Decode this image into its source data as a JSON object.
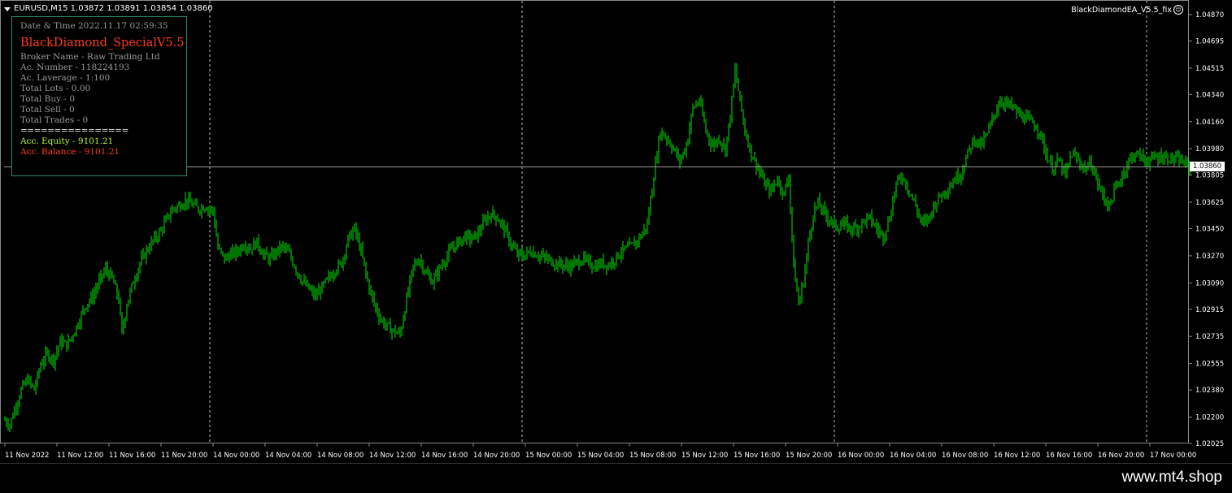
{
  "header": {
    "symbol_info": "EURUSD,M15  1.03872 1.03891 1.03854 1.03860"
  },
  "ea_label": {
    "text": "BlackDiamondEA_V5.5_fix"
  },
  "info_panel": {
    "datetime": "Date & Time 2022.11.17 02:59:35",
    "title": "BlackDiamond_SpecialV5.5",
    "broker": "Broker Name - Raw Trading Ltd",
    "account_number": "Ac. Number - 118224193",
    "leverage": "Ac. Laverage - 1:100",
    "total_lots": "Total Lots - 0.00",
    "total_buy": "Total Buy - 0",
    "total_sell": "Total Sell - 0",
    "total_trades": "Total Trades - 0",
    "separator": "================",
    "equity": "Acc. Equity - 9101.21",
    "balance": "Acc. Balance - 9101.21"
  },
  "current_price": "1.03860",
  "colors": {
    "candle": "#00e600",
    "background": "#000000",
    "equity": "#b7ff2a",
    "balance": "#ff3b1a",
    "title": "#ff3b1a",
    "panel_border": "#2e8b6e"
  },
  "chart_data": {
    "type": "candlestick",
    "price_ticks": [
      "1.04870",
      "1.04695",
      "1.04515",
      "1.04340",
      "1.04160",
      "1.03980",
      "1.03805",
      "1.03625",
      "1.03450",
      "1.03270",
      "1.03090",
      "1.02915",
      "1.02735",
      "1.02555",
      "1.02380",
      "1.02200",
      "1.02025"
    ],
    "price_range": [
      1.02025,
      1.0487
    ],
    "time_ticks": [
      "11 Nov 2022",
      "11 Nov 12:00",
      "11 Nov 16:00",
      "11 Nov 20:00",
      "14 Nov 00:00",
      "14 Nov 04:00",
      "14 Nov 08:00",
      "14 Nov 12:00",
      "14 Nov 16:00",
      "14 Nov 20:00",
      "15 Nov 00:00",
      "15 Nov 04:00",
      "15 Nov 08:00",
      "15 Nov 12:00",
      "15 Nov 16:00",
      "15 Nov 20:00",
      "16 Nov 00:00",
      "16 Nov 04:00",
      "16 Nov 08:00",
      "16 Nov 12:00",
      "16 Nov 16:00",
      "16 Nov 20:00",
      "17 Nov 00:00"
    ],
    "day_separators": [
      "14 Nov 00:00",
      "15 Nov 00:00",
      "16 Nov 00:00",
      "17 Nov 00:00"
    ],
    "close_path": [
      [
        0,
        1.0218
      ],
      [
        6,
        1.0215
      ],
      [
        12,
        1.0225
      ],
      [
        20,
        1.0238
      ],
      [
        28,
        1.0245
      ],
      [
        36,
        1.0238
      ],
      [
        44,
        1.0255
      ],
      [
        52,
        1.0262
      ],
      [
        60,
        1.0258
      ],
      [
        68,
        1.027
      ],
      [
        76,
        1.0268
      ],
      [
        84,
        1.0275
      ],
      [
        92,
        1.0285
      ],
      [
        100,
        1.0295
      ],
      [
        108,
        1.03
      ],
      [
        116,
        1.031
      ],
      [
        124,
        1.0318
      ],
      [
        132,
        1.0312
      ],
      [
        140,
        1.0298
      ],
      [
        144,
        1.0275
      ],
      [
        150,
        1.0295
      ],
      [
        158,
        1.031
      ],
      [
        166,
        1.0322
      ],
      [
        174,
        1.033
      ],
      [
        182,
        1.0337
      ],
      [
        190,
        1.0342
      ],
      [
        198,
        1.035
      ],
      [
        206,
        1.0358
      ],
      [
        214,
        1.036
      ],
      [
        222,
        1.0364
      ],
      [
        230,
        1.0361
      ],
      [
        238,
        1.0358
      ],
      [
        246,
        1.036
      ],
      [
        256,
        1.0357
      ],
      [
        262,
        1.0332
      ],
      [
        270,
        1.0325
      ],
      [
        278,
        1.0328
      ],
      [
        286,
        1.033
      ],
      [
        294,
        1.0335
      ],
      [
        302,
        1.0332
      ],
      [
        310,
        1.0336
      ],
      [
        318,
        1.0328
      ],
      [
        326,
        1.0325
      ],
      [
        334,
        1.033
      ],
      [
        342,
        1.0333
      ],
      [
        350,
        1.0328
      ],
      [
        358,
        1.0318
      ],
      [
        366,
        1.031
      ],
      [
        374,
        1.0305
      ],
      [
        382,
        1.03
      ],
      [
        390,
        1.0306
      ],
      [
        398,
        1.0312
      ],
      [
        406,
        1.0318
      ],
      [
        414,
        1.0322
      ],
      [
        422,
        1.0338
      ],
      [
        430,
        1.0345
      ],
      [
        438,
        1.033
      ],
      [
        446,
        1.031
      ],
      [
        454,
        1.0295
      ],
      [
        462,
        1.0285
      ],
      [
        470,
        1.028
      ],
      [
        478,
        1.0277
      ],
      [
        486,
        1.0275
      ],
      [
        494,
        1.0298
      ],
      [
        502,
        1.032
      ],
      [
        510,
        1.0325
      ],
      [
        518,
        1.0315
      ],
      [
        526,
        1.031
      ],
      [
        534,
        1.0318
      ],
      [
        542,
        1.0325
      ],
      [
        550,
        1.0332
      ],
      [
        558,
        1.0336
      ],
      [
        566,
        1.034
      ],
      [
        574,
        1.0338
      ],
      [
        582,
        1.0342
      ],
      [
        590,
        1.035
      ],
      [
        598,
        1.0355
      ],
      [
        606,
        1.0352
      ],
      [
        614,
        1.0345
      ],
      [
        622,
        1.0335
      ],
      [
        630,
        1.0328
      ],
      [
        638,
        1.0327
      ],
      [
        646,
        1.033
      ],
      [
        654,
        1.0328
      ],
      [
        662,
        1.0326
      ],
      [
        670,
        1.0324
      ],
      [
        678,
        1.0322
      ],
      [
        686,
        1.0321
      ],
      [
        694,
        1.032
      ],
      [
        702,
        1.0322
      ],
      [
        710,
        1.0325
      ],
      [
        718,
        1.0322
      ],
      [
        726,
        1.032
      ],
      [
        734,
        1.0322
      ],
      [
        742,
        1.0321
      ],
      [
        750,
        1.0325
      ],
      [
        758,
        1.033
      ],
      [
        766,
        1.0332
      ],
      [
        774,
        1.0335
      ],
      [
        782,
        1.034
      ],
      [
        790,
        1.0348
      ],
      [
        798,
        1.038
      ],
      [
        806,
        1.041
      ],
      [
        814,
        1.0405
      ],
      [
        822,
        1.0398
      ],
      [
        830,
        1.039
      ],
      [
        838,
        1.04
      ],
      [
        846,
        1.0425
      ],
      [
        854,
        1.043
      ],
      [
        862,
        1.041
      ],
      [
        870,
        1.04
      ],
      [
        878,
        1.0405
      ],
      [
        886,
        1.0398
      ],
      [
        892,
        1.042
      ],
      [
        898,
        1.045
      ],
      [
        904,
        1.043
      ],
      [
        910,
        1.041
      ],
      [
        918,
        1.0395
      ],
      [
        926,
        1.0385
      ],
      [
        934,
        1.0375
      ],
      [
        942,
        1.037
      ],
      [
        950,
        1.0378
      ],
      [
        958,
        1.0368
      ],
      [
        964,
        1.038
      ],
      [
        970,
        1.032
      ],
      [
        976,
        1.0295
      ],
      [
        982,
        1.031
      ],
      [
        988,
        1.0335
      ],
      [
        994,
        1.0355
      ],
      [
        1000,
        1.0362
      ],
      [
        1008,
        1.0355
      ],
      [
        1016,
        1.035
      ],
      [
        1024,
        1.0346
      ],
      [
        1032,
        1.0348
      ],
      [
        1040,
        1.0345
      ],
      [
        1048,
        1.0346
      ],
      [
        1056,
        1.035
      ],
      [
        1064,
        1.0352
      ],
      [
        1072,
        1.0345
      ],
      [
        1080,
        1.034
      ],
      [
        1088,
        1.0352
      ],
      [
        1096,
        1.0375
      ],
      [
        1104,
        1.038
      ],
      [
        1112,
        1.037
      ],
      [
        1120,
        1.036
      ],
      [
        1128,
        1.0348
      ],
      [
        1136,
        1.0352
      ],
      [
        1144,
        1.0362
      ],
      [
        1152,
        1.0368
      ],
      [
        1160,
        1.0372
      ],
      [
        1168,
        1.0378
      ],
      [
        1176,
        1.0382
      ],
      [
        1184,
        1.0395
      ],
      [
        1192,
        1.0405
      ],
      [
        1200,
        1.04
      ],
      [
        1208,
        1.0408
      ],
      [
        1216,
        1.042
      ],
      [
        1224,
        1.043
      ],
      [
        1232,
        1.0428
      ],
      [
        1240,
        1.0425
      ],
      [
        1248,
        1.042
      ],
      [
        1256,
        1.0418
      ],
      [
        1264,
        1.0415
      ],
      [
        1272,
        1.041
      ],
      [
        1280,
        1.0395
      ],
      [
        1288,
        1.0385
      ],
      [
        1296,
        1.039
      ],
      [
        1304,
        1.038
      ],
      [
        1312,
        1.0395
      ],
      [
        1320,
        1.039
      ],
      [
        1328,
        1.0385
      ],
      [
        1336,
        1.0388
      ],
      [
        1344,
        1.0375
      ],
      [
        1352,
        1.0365
      ],
      [
        1358,
        1.036
      ],
      [
        1366,
        1.0372
      ],
      [
        1374,
        1.038
      ],
      [
        1382,
        1.039
      ],
      [
        1390,
        1.0395
      ],
      [
        1398,
        1.0392
      ],
      [
        1406,
        1.039
      ],
      [
        1414,
        1.0392
      ],
      [
        1422,
        1.0393
      ],
      [
        1430,
        1.0392
      ],
      [
        1438,
        1.0391
      ],
      [
        1446,
        1.039
      ],
      [
        1454,
        1.0387
      ],
      [
        1458,
        1.0386
      ]
    ]
  },
  "footer": {
    "watermark": "www.mt4.shop"
  }
}
